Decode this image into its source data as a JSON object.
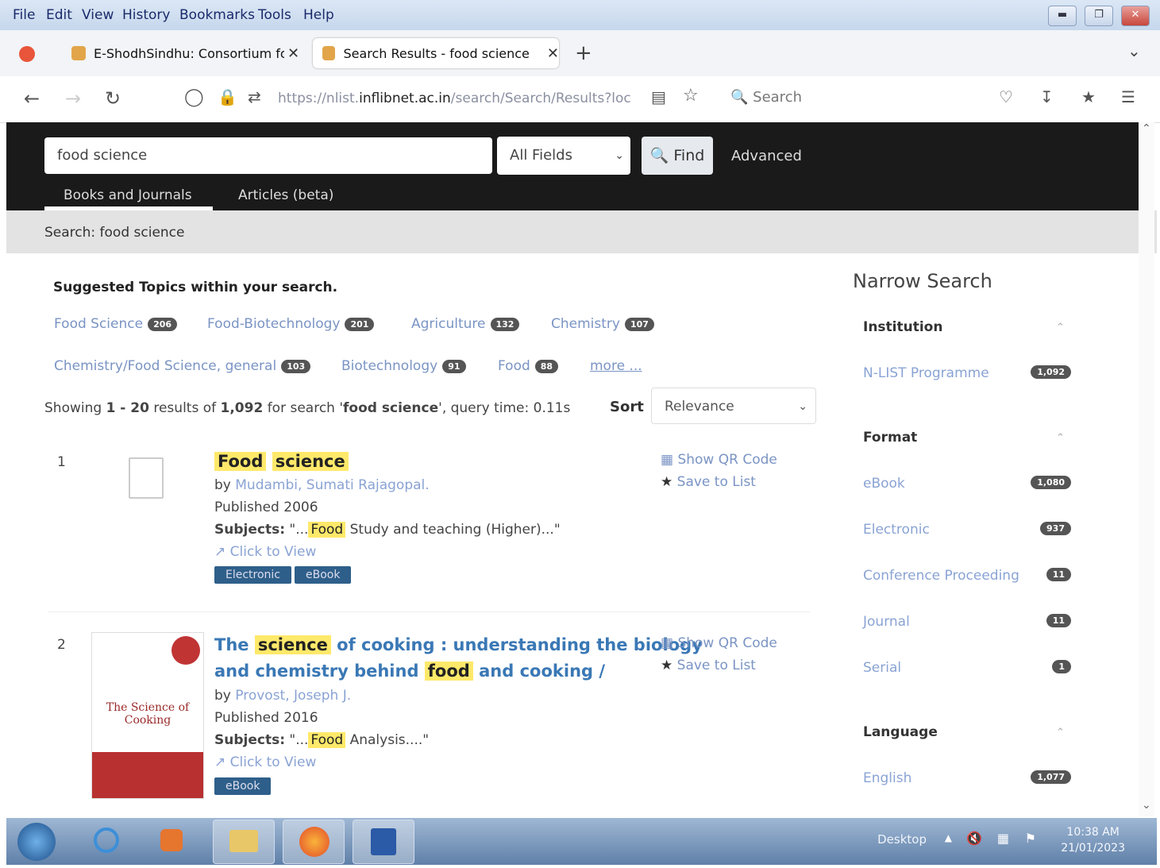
{
  "menu": [
    "File",
    "Edit",
    "View",
    "History",
    "Bookmarks",
    "Tools",
    "Help"
  ],
  "tabs": [
    {
      "title": "E-ShodhSindhu: Consortium fo"
    },
    {
      "title": "Search Results - food science"
    }
  ],
  "url": {
    "prefix": "https://nlist.",
    "domain": "inflibnet.ac.in",
    "path": "/search/Search/Results?loc"
  },
  "browser_search_label": "Search",
  "search": {
    "query": "food science",
    "field": "All Fields",
    "find_label": "Find",
    "advanced_label": "Advanced",
    "tabs": [
      "Books and Journals",
      "Articles (beta)"
    ],
    "breadcrumb": "Search: food science"
  },
  "suggested": {
    "heading": "Suggested Topics within your search.",
    "topics": [
      {
        "label": "Food Science",
        "count": "206"
      },
      {
        "label": "Food-Biotechnology",
        "count": "201"
      },
      {
        "label": "Agriculture",
        "count": "132"
      },
      {
        "label": "Chemistry",
        "count": "107"
      },
      {
        "label": "Chemistry/Food Science, general",
        "count": "103"
      },
      {
        "label": "Biotechnology",
        "count": "91"
      },
      {
        "label": "Food",
        "count": "88"
      }
    ],
    "more": "more ..."
  },
  "results_summary": {
    "showing": "Showing ",
    "range": "1 - 20",
    "results_of": " results of ",
    "total": "1,092",
    "for_search": " for search '",
    "query": "food science",
    "query_time": "', query time: 0.11s"
  },
  "sort": {
    "label": "Sort",
    "value": "Relevance"
  },
  "results": [
    {
      "num": "1",
      "title_parts": [
        "Food",
        "science"
      ],
      "by": "by ",
      "author": "Mudambi, Sumati Rajagopal.",
      "published": "Published 2006",
      "subjects_label": "Subjects:",
      "subjects_pre": " \"...",
      "subjects_hl": "Food",
      "subjects_post": " Study and teaching (Higher)...\"",
      "view": "Click to View",
      "formats": [
        "Electronic",
        "eBook"
      ],
      "qr": "Show QR Code",
      "save": "Save to List"
    },
    {
      "num": "2",
      "title_a": "The ",
      "title_hl1": "science",
      "title_b": " of cooking : understanding the biology",
      "title_c": "and chemistry behind ",
      "title_hl2": "food",
      "title_d": " and cooking /",
      "by": "by ",
      "author": "Provost, Joseph J.",
      "published": "Published 2016",
      "subjects_label": "Subjects:",
      "subjects_pre": " \"...",
      "subjects_hl": "Food",
      "subjects_post": " Analysis....\"",
      "view": "Click to View",
      "formats": [
        "eBook"
      ],
      "qr": "Show QR Code",
      "save": "Save to List",
      "cover_title": "The Science of Cooking"
    }
  ],
  "narrow": {
    "heading": "Narrow Search",
    "institution": {
      "title": "Institution",
      "items": [
        {
          "label": "N-LIST Programme",
          "count": "1,092"
        }
      ]
    },
    "format": {
      "title": "Format",
      "items": [
        {
          "label": "eBook",
          "count": "1,080"
        },
        {
          "label": "Electronic",
          "count": "937"
        },
        {
          "label": "Conference Proceeding",
          "count": "11"
        },
        {
          "label": "Journal",
          "count": "11"
        },
        {
          "label": "Serial",
          "count": "1"
        }
      ]
    },
    "language": {
      "title": "Language",
      "items": [
        {
          "label": "English",
          "count": "1,077"
        }
      ]
    }
  },
  "taskbar": {
    "desktop": "Desktop",
    "time": "10:38 AM",
    "date": "21/01/2023"
  }
}
